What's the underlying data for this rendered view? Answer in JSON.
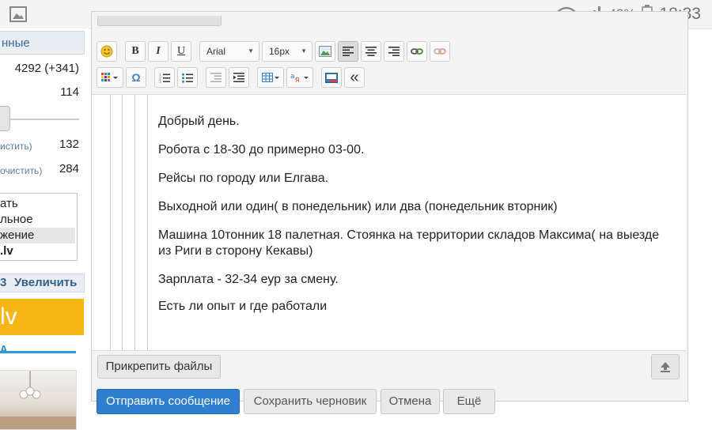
{
  "status_bar": {
    "battery": "42%",
    "time": "18:33",
    "icons": [
      "gallery-icon",
      "wifi-icon",
      "signal-icon",
      "battery-icon"
    ]
  },
  "sidebar": {
    "tab_label": "нные",
    "stats": [
      {
        "label": "",
        "value": "4292 (+341)"
      },
      {
        "label": "",
        "value": "114"
      },
      {
        "label": "истить)",
        "value": "132"
      },
      {
        "label": "очистить)",
        "value": "284"
      }
    ],
    "select_options": [
      "ать",
      "льное",
      "жение",
      ".lv"
    ],
    "zoom_prefix": "3",
    "zoom_label": "Увеличить",
    "banner_text": "lv",
    "banner_sub": "A"
  },
  "toolbar": {
    "font_family": "Arial",
    "font_size": "16px",
    "icons_row1": [
      "smiley-icon",
      "bold-icon",
      "italic-icon",
      "underline-icon",
      "image-icon",
      "align-left-icon",
      "align-center-icon",
      "align-right-icon",
      "link-icon",
      "unlink-icon"
    ],
    "icons_row2": [
      "text-color-icon",
      "omega-icon",
      "ordered-list-icon",
      "unordered-list-icon",
      "outdent-icon",
      "indent-icon",
      "table-icon",
      "spellcheck-icon",
      "media-icon",
      "collapse-icon"
    ],
    "bold_label": "B",
    "italic_label": "I",
    "underline_label": "U",
    "omega_label": "Ω",
    "collapse_label": "«"
  },
  "message": {
    "paragraphs": [
      "Добрый день.",
      "Робота с 18-30 до примерно 03-00.",
      "Рейсы по городу или Елгава.",
      "Выходной или один( в понедельник) или два (понедельник вторник)",
      "Машина 10тонник 18 палетная. Стоянка на территории складов Максима( на выезде из Риги в сторону Кекавы)",
      "Зарплата - 32-34 еур за смену.",
      "Есть ли опыт и где работали"
    ]
  },
  "buttons": {
    "attach": "Прикрепить файлы",
    "send": "Отправить сообщение",
    "save_draft": "Сохранить черновик",
    "cancel": "Отмена",
    "more": "Ещё"
  },
  "colors": {
    "send_button": "#2e7fd0",
    "banner": "#f7b718",
    "link_blue": "#3a6b9a"
  }
}
